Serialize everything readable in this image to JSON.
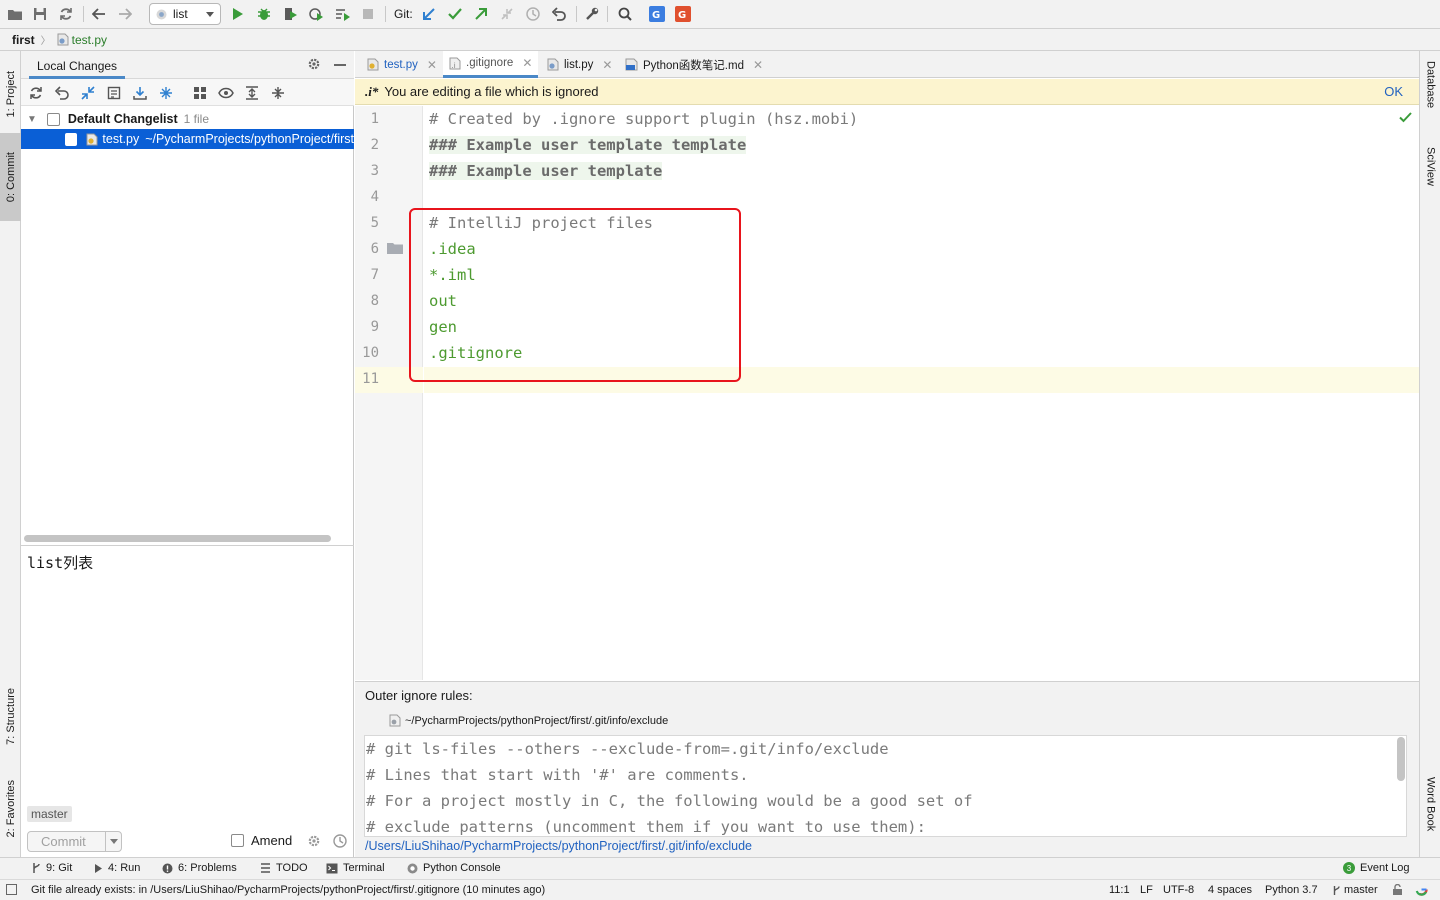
{
  "toolbar": {
    "run_config": "list",
    "git_label": "Git:"
  },
  "navbar": {
    "project": "first",
    "file": "test.py"
  },
  "left_stripe": {
    "project": "1: Project",
    "commit": "0: Commit",
    "structure": "7: Structure",
    "favorites": "2: Favorites"
  },
  "right_stripe": {
    "database": "Database",
    "sciview": "SciView",
    "wordbook": "Word Book"
  },
  "commit_panel": {
    "tab": "Local Changes",
    "changelist_name": "Default Changelist",
    "changelist_count": "1 file",
    "file_name": "test.py",
    "file_path": "~/PycharmProjects/pythonProject/first",
    "message": "list列表",
    "branch": "master",
    "commit_button": "Commit",
    "amend_label": "Amend"
  },
  "editor_tabs": [
    {
      "label": "test.py"
    },
    {
      "label": ".gitignore"
    },
    {
      "label": "list.py"
    },
    {
      "label": "Python函数笔记.md"
    }
  ],
  "banner": {
    "icon_text": ".i*",
    "message": "You are editing a file which is ignored",
    "ok": "OK"
  },
  "code_lines": [
    {
      "num": "1",
      "text": "# Created by .ignore support plugin (hsz.mobi)"
    },
    {
      "num": "2",
      "text": "### Example user template template"
    },
    {
      "num": "3",
      "text": "### Example user template"
    },
    {
      "num": "4",
      "text": ""
    },
    {
      "num": "5",
      "text": "# IntelliJ project files"
    },
    {
      "num": "6",
      "text": ".idea"
    },
    {
      "num": "7",
      "text": "*.iml"
    },
    {
      "num": "8",
      "text": "out"
    },
    {
      "num": "9",
      "text": "gen"
    },
    {
      "num": "10",
      "text": ".gitignore"
    },
    {
      "num": "11",
      "text": ""
    }
  ],
  "outer_rules": {
    "title": "Outer ignore rules:",
    "path": "~/PycharmProjects/pythonProject/first/.git/info/exclude",
    "lines": [
      "# git ls-files --others --exclude-from=.git/info/exclude",
      "# Lines that start with '#' are comments.",
      "# For a project mostly in C, the following would be a good set of",
      "# exclude patterns (uncomment them if you want to use them):"
    ],
    "link": "/Users/LiuShihao/PycharmProjects/pythonProject/first/.git/info/exclude"
  },
  "tool_windows": {
    "git": "9: Git",
    "run": "4: Run",
    "problems": "6: Problems",
    "todo": "TODO",
    "terminal": "Terminal",
    "console": "Python Console",
    "event_log": "Event Log",
    "event_count": "3"
  },
  "status": {
    "message": "Git file already exists: in /Users/LiuShihao/PycharmProjects/pythonProject/first/.gitignore (10 minutes ago)",
    "position": "11:1",
    "line_sep": "LF",
    "encoding": "UTF-8",
    "indent": "4 spaces",
    "interpreter": "Python 3.7",
    "branch": "master"
  },
  "colors": {
    "accent": "#4a88c7",
    "selection": "#0a5fd6",
    "highlight_box": "#e8141c",
    "ignored_green": "#4d9a30",
    "banner_bg": "#fcf4cf"
  }
}
